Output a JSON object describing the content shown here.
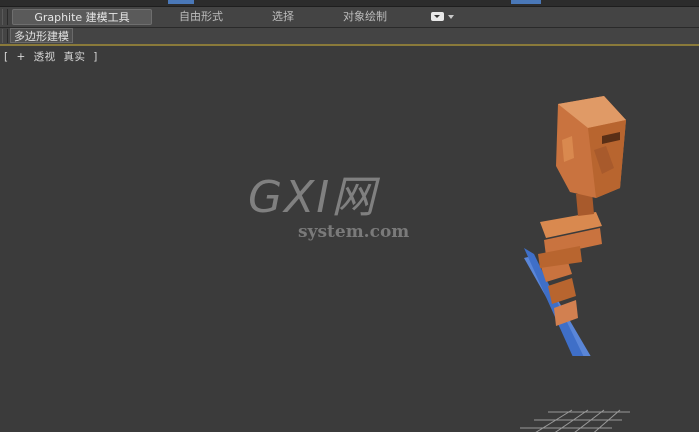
{
  "ribbon": {
    "tabs": [
      {
        "label": "Graphite 建模工具",
        "active": true
      },
      {
        "label": "自由形式",
        "active": false
      },
      {
        "label": "选择",
        "active": false
      },
      {
        "label": "对象绘制",
        "active": false
      }
    ]
  },
  "panel": {
    "label": "多边形建模"
  },
  "viewport": {
    "label_open": "[",
    "label_plus": "+",
    "label_view": "透视",
    "label_shading": "真实",
    "label_close": "]"
  },
  "watermark": {
    "main": "GXI网",
    "sub": "system.com"
  },
  "colors": {
    "viewport_bg": "#3b3b3b",
    "figure_orange": "#c9733f",
    "base_blue": "#3f6fc8",
    "accent_line": "#8a7a3a"
  }
}
